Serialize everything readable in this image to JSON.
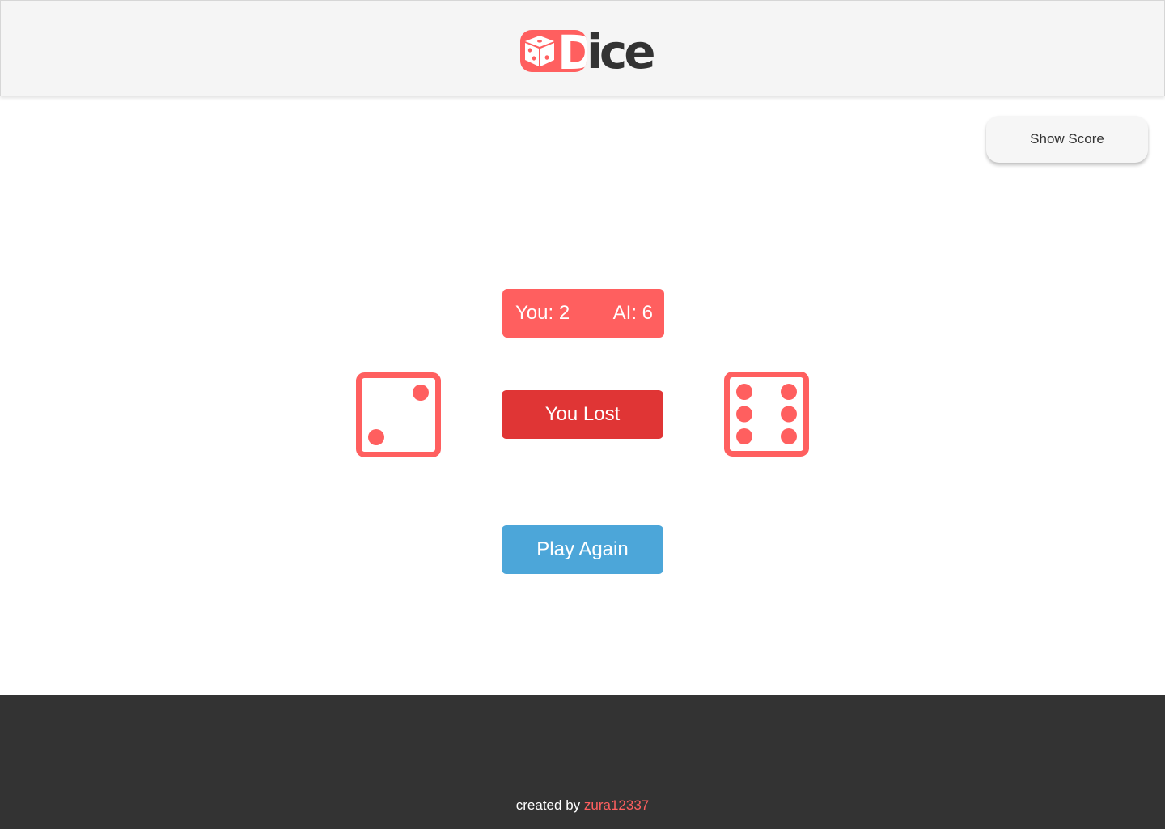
{
  "header": {
    "logo_letter": "D",
    "logo_rest": "ice"
  },
  "controls": {
    "show_score_label": "Show Score",
    "play_again_label": "Play Again"
  },
  "scoreboard": {
    "you_text": "You: 2",
    "ai_text": "AI: 6"
  },
  "game": {
    "player_die_value": 2,
    "ai_die_value": 6,
    "result_text": "You Lost"
  },
  "footer": {
    "credit_prefix": "created by",
    "author": "zura12337"
  },
  "colors": {
    "accent": "#ff5f5f",
    "lost": "#e03535",
    "play_again": "#4ca6d9",
    "footer_bg": "#333333"
  }
}
